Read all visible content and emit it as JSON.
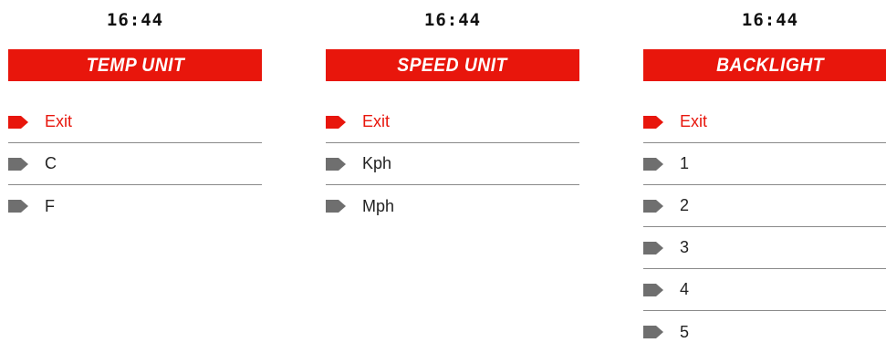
{
  "colors": {
    "accent": "#e8160c",
    "arrow_inactive": "#6f6f6f",
    "divider": "#8a8a8a"
  },
  "panels": [
    {
      "time": "16:44",
      "title": "TEMP UNIT",
      "items": [
        {
          "label": "Exit",
          "selected": true
        },
        {
          "label": "C",
          "selected": false
        },
        {
          "label": "F",
          "selected": false
        }
      ]
    },
    {
      "time": "16:44",
      "title": "SPEED UNIT",
      "items": [
        {
          "label": "Exit",
          "selected": true
        },
        {
          "label": "Kph",
          "selected": false
        },
        {
          "label": "Mph",
          "selected": false
        }
      ]
    },
    {
      "time": "16:44",
      "title": "BACKLIGHT",
      "items": [
        {
          "label": "Exit",
          "selected": true
        },
        {
          "label": "1",
          "selected": false
        },
        {
          "label": "2",
          "selected": false
        },
        {
          "label": "3",
          "selected": false
        },
        {
          "label": "4",
          "selected": false
        },
        {
          "label": "5",
          "selected": false
        }
      ]
    }
  ]
}
